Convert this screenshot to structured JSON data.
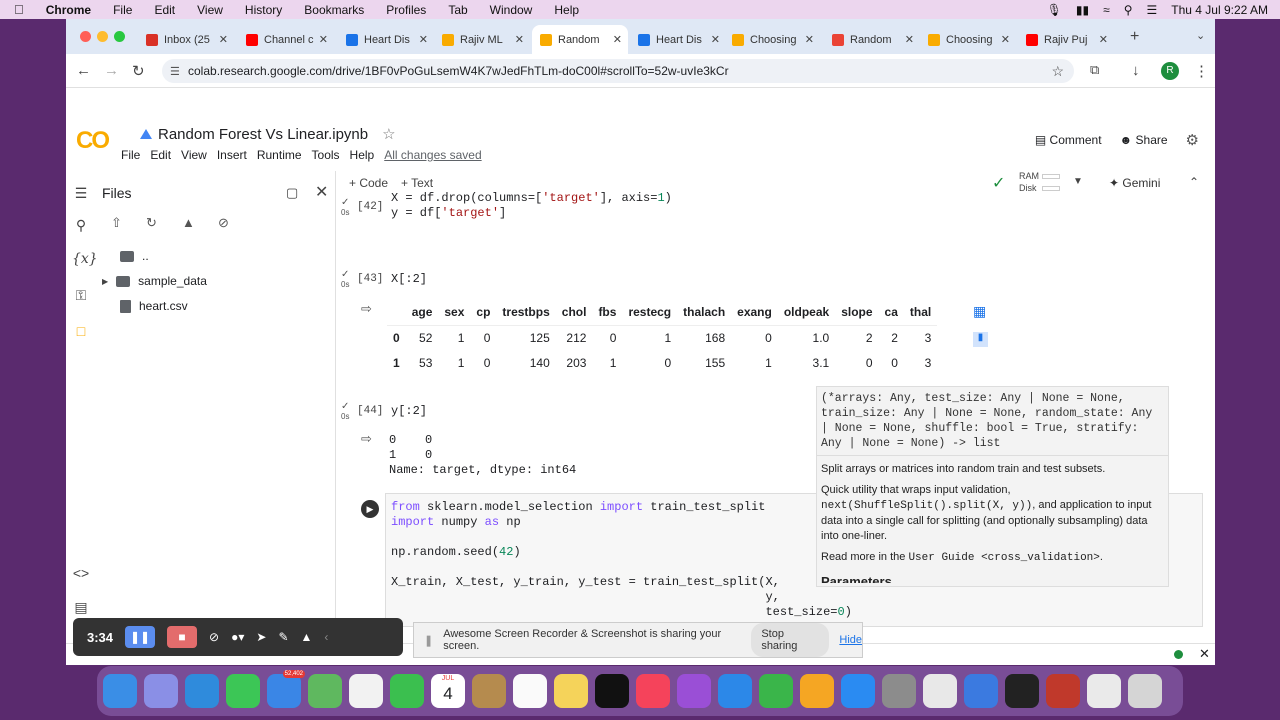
{
  "mac_menubar": {
    "app": "Chrome",
    "menus": [
      "File",
      "Edit",
      "View",
      "History",
      "Bookmarks",
      "Profiles",
      "Tab",
      "Window",
      "Help"
    ],
    "clock": "Thu 4 Jul  9:22 AM"
  },
  "tabs": [
    {
      "label": "Inbox (25",
      "color": "#d93025"
    },
    {
      "label": "Channel c",
      "color": "#ff0000"
    },
    {
      "label": "Heart Dis",
      "color": "#1a73e8"
    },
    {
      "label": "Rajiv ML",
      "color": "#f9ab00"
    },
    {
      "label": "Random",
      "color": "#f9ab00",
      "active": true
    },
    {
      "label": "Heart Dis",
      "color": "#1a73e8"
    },
    {
      "label": "Choosing",
      "color": "#f9ab00"
    },
    {
      "label": "Random",
      "color": "#ea4335"
    },
    {
      "label": "Choosing",
      "color": "#f9ab00"
    },
    {
      "label": "Rajiv Puj",
      "color": "#ff0000"
    }
  ],
  "url": "colab.research.google.com/drive/1BF0vPoGuLsemW4K7wJedFhTLm-doC00l#scrollTo=52w-uvIe3kCr",
  "profile_initial": "R",
  "notebook": {
    "logo": "CO",
    "title": "Random Forest Vs Linear.ipynb",
    "menus": [
      "File",
      "Edit",
      "View",
      "Insert",
      "Runtime",
      "Tools",
      "Help"
    ],
    "saved": "All changes saved",
    "comment": "Comment",
    "share": "Share"
  },
  "toolbar": {
    "code": "+ Code",
    "text": "+ Text",
    "ram": "RAM",
    "disk": "Disk",
    "gemini": "Gemini"
  },
  "sidebar": {
    "title": "Files",
    "items": [
      {
        "label": ".."
      },
      {
        "label": "sample_data"
      },
      {
        "label": "heart.csv"
      }
    ]
  },
  "cells": {
    "c42": {
      "num": "[42]",
      "time": "0s"
    },
    "c43": {
      "num": "[43]",
      "code": "X[:2]",
      "time": "0s"
    },
    "c44": {
      "num": "[44]",
      "code": "y[:2]",
      "time": "0s",
      "output": "0    0\n1    0\nName: target, dtype: int64"
    }
  },
  "table": {
    "columns": [
      "",
      "age",
      "sex",
      "cp",
      "trestbps",
      "chol",
      "fbs",
      "restecg",
      "thalach",
      "exang",
      "oldpeak",
      "slope",
      "ca",
      "thal"
    ],
    "rows": [
      [
        "0",
        "52",
        "1",
        "0",
        "125",
        "212",
        "0",
        "1",
        "168",
        "0",
        "1.0",
        "2",
        "2",
        "3"
      ],
      [
        "1",
        "53",
        "1",
        "0",
        "140",
        "203",
        "1",
        "0",
        "155",
        "1",
        "3.1",
        "0",
        "0",
        "3"
      ]
    ]
  },
  "tooltip": {
    "signature": "(*arrays: Any, test_size: Any | None = None, train_size: Any | None = None, random_state: Any | None = None, shuffle: bool = True, stratify: Any | None = None) -> list",
    "summary": "Split arrays or matrices into random train and test subsets.",
    "detail1": "Quick utility that wraps input validation,",
    "detail_code": "next(ShuffleSplit().split(X, y))",
    "detail2": ", and application to input data into a single call for splitting (and optionally subsampling) data into one-liner.",
    "read_more": "Read more in the",
    "guide": "User Guide <cross_validation>",
    "dot": ".",
    "params_heading": "Parameters"
  },
  "recorder": {
    "time": "3:34"
  },
  "sharebar": {
    "message": "Awesome Screen Recorder & Screenshot is sharing your screen.",
    "stop": "Stop sharing",
    "hide": "Hide"
  },
  "dock_badges": {
    "mail": "52,402",
    "calendar_month": "JUL",
    "calendar_day": "4"
  }
}
